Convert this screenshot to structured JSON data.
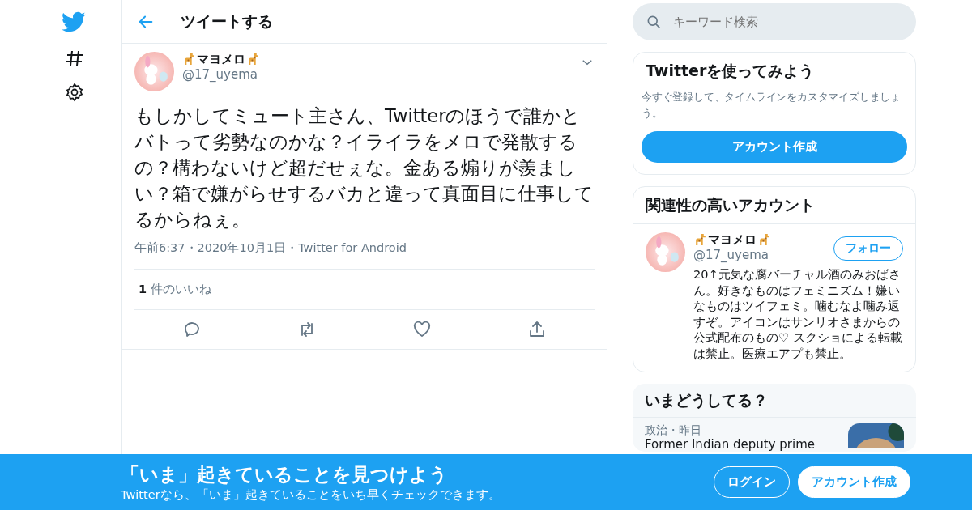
{
  "header": {
    "title": "ツイートする"
  },
  "tweet": {
    "display_name": "マヨメロ",
    "handle": "@17_uyema",
    "text": "もしかしてミュート主さん、Twitterのほうで誰かとバトって劣勢なのかな？イライラをメロで発散するの？構わないけど超だせぇな。金ある煽りが羨ましい？箱で嫌がらせするバカと違って真面目に仕事してるからねぇ。",
    "meta": "午前6:37・2020年10月1日・Twitter for Android",
    "likes": "**1** 件のいいね"
  },
  "search": {
    "placeholder": "キーワード検索"
  },
  "signup_card": {
    "title": "Twitterを使ってみよう",
    "description": "今すぐ登録して、タイムラインをカスタマイズしましょう。",
    "button": "アカウント作成"
  },
  "related": {
    "title": "関連性の高いアカウント",
    "accounts": [
      {
        "display_name": "マヨメロ",
        "handle": "@17_uyema",
        "button": "フォロー",
        "bio": "20↑元気な腐バーチャル酒のみおばさん。好きなものはフェミニズム！嫌いなものはツイフェミ。噛むなよ噛み返すぞ。アイコンはサンリオさまからの公式配布のもの♡ スクショによる転載は禁止。医療エアプも禁止。"
      }
    ]
  },
  "trends": {
    "title": "いまどうしてる？",
    "items": [
      {
        "meta": "政治・昨日",
        "headline": "Former Indian deputy prime",
        "kind": "picture"
      }
    ]
  },
  "banner": {
    "title": "「いま」起きていることを見つけよう",
    "subtitle": "Twitterなら、「いま」起きていることをいち早くチェックできます。",
    "buttons": [
      {
        "label": "ログイン",
        "kind": "outline"
      },
      {
        "label": "アカウント作成",
        "kind": "filled"
      }
    ]
  }
}
